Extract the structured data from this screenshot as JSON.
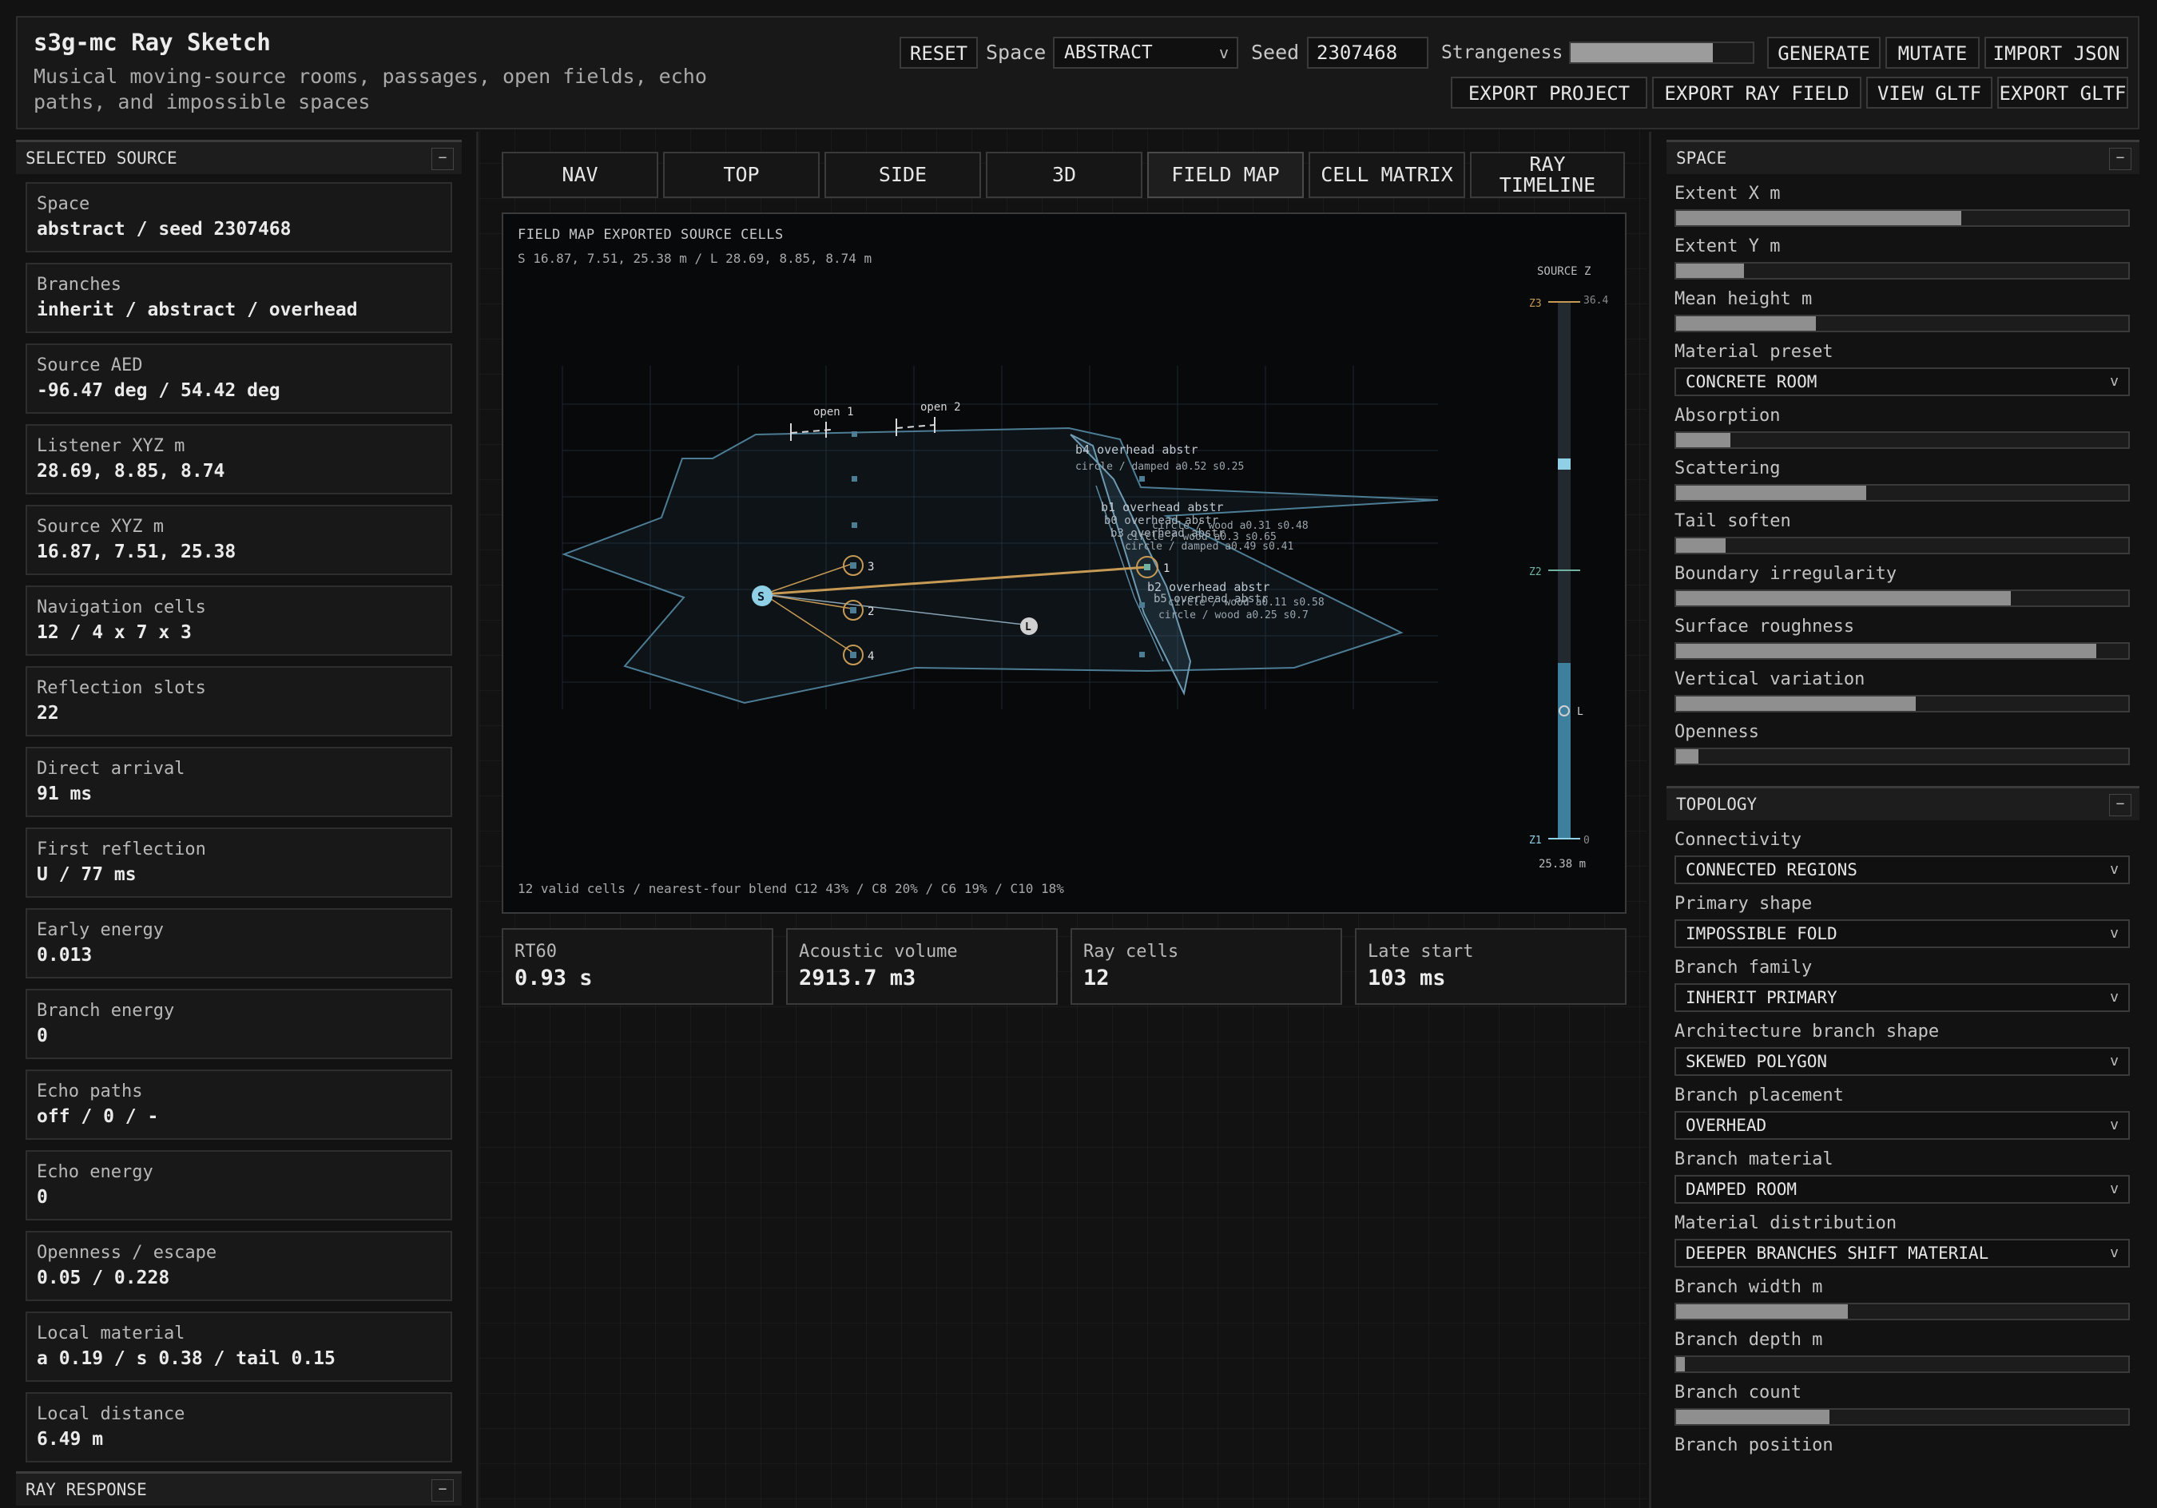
{
  "header": {
    "title": "s3g-mc Ray Sketch",
    "subtitle": "Musical moving-source rooms, passages, open fields, echo paths, and impossible spaces",
    "reset_label": "RESET",
    "space_label": "Space",
    "space_value": "ABSTRACT",
    "seed_label": "Seed",
    "seed_value": "2307468",
    "strangeness_label": "Strangeness",
    "strangeness_level": 0.78,
    "generate_label": "GENERATE",
    "mutate_label": "MUTATE",
    "import_json_label": "IMPORT JSON",
    "export_project_label": "EXPORT PROJECT",
    "export_ray_field_label": "EXPORT RAY FIELD",
    "view_gltf_label": "VIEW GLTF",
    "export_gltf_label": "EXPORT GLTF"
  },
  "left": {
    "section_title": "SELECTED SOURCE",
    "collapse_symbol": "−",
    "stats": [
      {
        "label": "Space",
        "value": "abstract / seed 2307468"
      },
      {
        "label": "Branches",
        "value": "inherit / abstract / overhead"
      },
      {
        "label": "Source AED",
        "value": "-96.47 deg / 54.42 deg"
      },
      {
        "label": "Listener XYZ m",
        "value": "28.69, 8.85, 8.74"
      },
      {
        "label": "Source XYZ m",
        "value": "16.87, 7.51, 25.38"
      },
      {
        "label": "Navigation cells",
        "value": "12 / 4 x 7 x 3"
      },
      {
        "label": "Reflection slots",
        "value": "22"
      },
      {
        "label": "Direct arrival",
        "value": "91 ms"
      },
      {
        "label": "First reflection",
        "value": "U / 77 ms"
      },
      {
        "label": "Early energy",
        "value": "0.013"
      },
      {
        "label": "Branch energy",
        "value": "0"
      },
      {
        "label": "Echo paths",
        "value": "off / 0 / -"
      },
      {
        "label": "Echo energy",
        "value": "0"
      },
      {
        "label": "Openness / escape",
        "value": "0.05 / 0.228"
      },
      {
        "label": "Local material",
        "value": "a 0.19 / s 0.38 / tail 0.15"
      },
      {
        "label": "Local distance",
        "value": "6.49 m"
      }
    ],
    "ray_response_title": "RAY RESPONSE"
  },
  "tabs": [
    "NAV",
    "TOP",
    "SIDE",
    "3D",
    "FIELD MAP",
    "CELL MATRIX",
    "RAY TIMELINE"
  ],
  "active_tab": "FIELD MAP",
  "field_map": {
    "title": "FIELD MAP  EXPORTED SOURCE CELLS",
    "coords": "S 16.87, 7.51, 25.38 m / L 28.69, 8.85, 8.74 m",
    "footer": "12 valid cells / nearest-four blend C12 43% / C8 20% / C6 19% / C10 18%",
    "source_marker": "S",
    "listener_marker": "L",
    "openings": [
      "open 1",
      "open 2"
    ],
    "cell_numbers": [
      "1",
      "2",
      "3",
      "4"
    ],
    "branch_labels": [
      {
        "name": "b4 overhead abstr",
        "detail": "circle / damped a0.52 s0.25"
      },
      {
        "name": "b1 overhead abstr",
        "detail": "circle / damped a0.49 s0.41"
      },
      {
        "name": "b0 overhead abstr",
        "detail": "circle / wood a0.31 s0.48"
      },
      {
        "name": "b3 overhead abstr",
        "detail": "circle / wood a0.3 s0.65"
      },
      {
        "name": "b2 overhead abstr",
        "detail": "circle / wood a0.25 s0.7"
      },
      {
        "name": "b5 overhead abstr",
        "detail": "circle / wood a0.11 s0.58"
      }
    ],
    "z_axis": {
      "title": "SOURCE Z",
      "top_label": "Z3",
      "top_value": "36.4",
      "mid_label": "Z2",
      "bottom_label": "Z1",
      "bottom_value": "0",
      "listener_label": "L",
      "readout": "25.38 m"
    },
    "colors": {
      "room": "#4d7d95",
      "source": "#8fd0e6",
      "ray": "#c69a55",
      "listener": "#d0d0d0"
    }
  },
  "metrics": [
    {
      "label": "RT60",
      "value": "0.93 s"
    },
    {
      "label": "Acoustic volume",
      "value": "2913.7 m3"
    },
    {
      "label": "Ray cells",
      "value": "12"
    },
    {
      "label": "Late start",
      "value": "103 ms"
    }
  ],
  "space_panel": {
    "title": "SPACE",
    "collapse_symbol": "−",
    "sliders_a": [
      {
        "label": "Extent X m",
        "level": 0.63
      },
      {
        "label": "Extent Y m",
        "level": 0.15
      },
      {
        "label": "Mean height m",
        "level": 0.31
      }
    ],
    "material_preset_label": "Material preset",
    "material_preset_value": "CONCRETE ROOM",
    "sliders_b": [
      {
        "label": "Absorption",
        "level": 0.12
      },
      {
        "label": "Scattering",
        "level": 0.42
      },
      {
        "label": "Tail soften",
        "level": 0.11
      },
      {
        "label": "Boundary irregularity",
        "level": 0.74
      },
      {
        "label": "Surface roughness",
        "level": 0.93
      },
      {
        "label": "Vertical variation",
        "level": 0.53
      },
      {
        "label": "Openness",
        "level": 0.05
      }
    ]
  },
  "topology_panel": {
    "title": "TOPOLOGY",
    "collapse_symbol": "−",
    "selects": [
      {
        "label": "Connectivity",
        "value": "CONNECTED REGIONS"
      },
      {
        "label": "Primary shape",
        "value": "IMPOSSIBLE FOLD"
      },
      {
        "label": "Branch family",
        "value": "INHERIT PRIMARY"
      },
      {
        "label": "Architecture branch shape",
        "value": "SKEWED POLYGON"
      },
      {
        "label": "Branch placement",
        "value": "OVERHEAD"
      },
      {
        "label": "Branch material",
        "value": "DAMPED ROOM"
      },
      {
        "label": "Material distribution",
        "value": "DEEPER BRANCHES SHIFT MATERIAL"
      }
    ],
    "sliders": [
      {
        "label": "Branch width m",
        "level": 0.38
      },
      {
        "label": "Branch depth m",
        "level": 0.02
      },
      {
        "label": "Branch count",
        "level": 0.34
      }
    ],
    "branch_position_label": "Branch position"
  }
}
